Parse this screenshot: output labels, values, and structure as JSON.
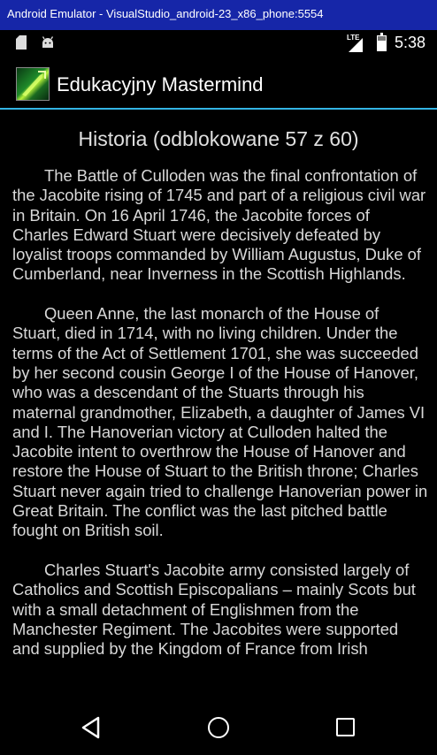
{
  "window": {
    "title": "Android Emulator - VisualStudio_android-23_x86_phone:5554"
  },
  "status_bar": {
    "icons": [
      "sd-card-icon",
      "android-debug-icon",
      "lte-signal-icon",
      "battery-icon"
    ],
    "network": "LTE",
    "time": "5:38"
  },
  "action_bar": {
    "app_icon": "app-logo-icon",
    "title": "Edukacyjny Mastermind",
    "accent_color": "#33b5e5"
  },
  "content": {
    "heading": "Historia (odblokowane 57 z 60)",
    "paragraphs": [
      "The Battle of Culloden was the final confrontation of the Jacobite rising of 1745 and part of a religious civil war in Britain. On 16 April 1746, the Jacobite forces of Charles Edward Stuart were decisively defeated by loyalist troops commanded by William Augustus, Duke of Cumberland, near Inverness in the Scottish Highlands.",
      "Queen Anne, the last monarch of the House of Stuart, died in 1714, with no living children. Under the terms of the Act of Settlement 1701, she was succeeded by her second cousin George I of the House of Hanover, who was a descendant of the Stuarts through his maternal grandmother, Elizabeth, a daughter of James VI and I. The Hanoverian victory at Culloden halted the Jacobite intent to overthrow the House of Hanover and restore the House of Stuart to the British throne; Charles Stuart never again tried to challenge Hanoverian power in Great Britain. The conflict was the last pitched battle fought on British soil.",
      "Charles Stuart's Jacobite army consisted largely of Catholics and Scottish Episcopalians – mainly Scots but with a small detachment of Englishmen from the Manchester Regiment. The Jacobites were supported and supplied by the Kingdom of France from Irish"
    ]
  },
  "nav_bar": {
    "icons": [
      "back-icon",
      "home-icon",
      "recent-apps-icon"
    ]
  }
}
